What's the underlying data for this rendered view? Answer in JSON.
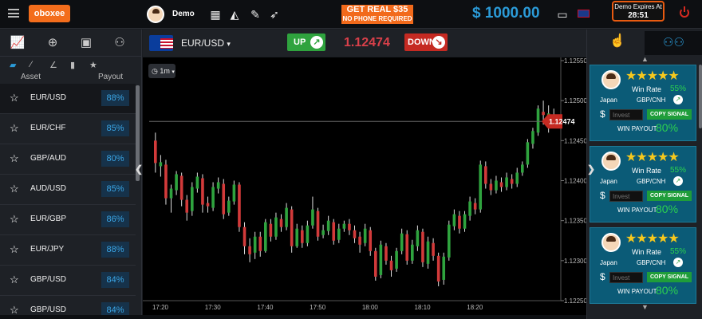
{
  "top": {
    "logo": "oboxee",
    "user": "Demo",
    "promo_line1": "GET REAL $35",
    "promo_line2": "NO PHONE REQUIRED",
    "balance": "$ 1000.00",
    "expiry_label": "Demo Expires At",
    "expiry_time": "28:51"
  },
  "left": {
    "head_asset": "Asset",
    "head_payout": "Payout",
    "assets": [
      {
        "name": "EUR/USD",
        "payout": "88%"
      },
      {
        "name": "EUR/CHF",
        "payout": "85%"
      },
      {
        "name": "GBP/AUD",
        "payout": "80%"
      },
      {
        "name": "AUD/USD",
        "payout": "85%"
      },
      {
        "name": "EUR/GBP",
        "payout": "86%"
      },
      {
        "name": "EUR/JPY",
        "payout": "88%"
      },
      {
        "name": "GBP/USD",
        "payout": "84%"
      },
      {
        "name": "GBP/USD",
        "payout": "84%"
      }
    ]
  },
  "chart_head": {
    "pair": "EUR/USD",
    "up": "UP",
    "price": "1.12474",
    "down": "DOWN",
    "timeframe": "1m"
  },
  "chart_data": {
    "type": "candlestick",
    "current_price": 1.12474,
    "ylim": [
      1.1225,
      1.1255
    ],
    "y_ticks": [
      "1.12550",
      "1.12500",
      "1.12450",
      "1.12400",
      "1.12350",
      "1.12300",
      "1.12250"
    ],
    "x_ticks": [
      "17:20",
      "17:30",
      "17:40",
      "17:50",
      "18:00",
      "18:10",
      "18:20"
    ],
    "candles": [
      [
        1.1245,
        1.12422,
        1.1246,
        1.1241
      ],
      [
        1.12418,
        1.12423,
        1.12432,
        1.12405
      ],
      [
        1.1242,
        1.12378,
        1.12426,
        1.1237
      ],
      [
        1.12378,
        1.1239,
        1.12395,
        1.1236
      ],
      [
        1.12388,
        1.12408,
        1.12412,
        1.12382
      ],
      [
        1.12406,
        1.12376,
        1.1241,
        1.12368
      ],
      [
        1.12376,
        1.1236,
        1.12382,
        1.1235
      ],
      [
        1.12362,
        1.12392,
        1.12398,
        1.12356
      ],
      [
        1.1239,
        1.12405,
        1.1241,
        1.12385
      ],
      [
        1.12403,
        1.1237,
        1.12408,
        1.1236
      ],
      [
        1.12372,
        1.12368,
        1.1238,
        1.1236
      ],
      [
        1.12366,
        1.12392,
        1.12398,
        1.12362
      ],
      [
        1.1239,
        1.12398,
        1.12404,
        1.12384
      ],
      [
        1.12396,
        1.12358,
        1.12402,
        1.12352
      ],
      [
        1.1236,
        1.12375,
        1.1238,
        1.12356
      ],
      [
        1.12374,
        1.12395,
        1.124,
        1.1237
      ],
      [
        1.12395,
        1.12342,
        1.12398,
        1.12336
      ],
      [
        1.12342,
        1.12318,
        1.12348,
        1.12308
      ],
      [
        1.12318,
        1.12308,
        1.12328,
        1.12298
      ],
      [
        1.1231,
        1.1233,
        1.12336,
        1.12302
      ],
      [
        1.1233,
        1.12312,
        1.12336,
        1.12305
      ],
      [
        1.12312,
        1.12348,
        1.12352,
        1.1231
      ],
      [
        1.12346,
        1.1233,
        1.12352,
        1.12324
      ],
      [
        1.1233,
        1.12354,
        1.1236,
        1.12326
      ],
      [
        1.12352,
        1.12342,
        1.12358,
        1.12336
      ],
      [
        1.12342,
        1.12366,
        1.12372,
        1.12338
      ],
      [
        1.12364,
        1.12318,
        1.12368,
        1.1231
      ],
      [
        1.12318,
        1.1234,
        1.12346,
        1.12316
      ],
      [
        1.12338,
        1.12322,
        1.12344,
        1.12316
      ],
      [
        1.12322,
        1.12344,
        1.1235,
        1.12318
      ],
      [
        1.12344,
        1.12364,
        1.1238,
        1.1234
      ],
      [
        1.12362,
        1.1233,
        1.12366,
        1.12325
      ],
      [
        1.12332,
        1.12338,
        1.12345,
        1.12328
      ],
      [
        1.12337,
        1.1235,
        1.12356,
        1.12332
      ],
      [
        1.12348,
        1.12325,
        1.12352,
        1.1232
      ],
      [
        1.12326,
        1.1234,
        1.12346,
        1.12322
      ],
      [
        1.1234,
        1.12346,
        1.1235,
        1.12336
      ],
      [
        1.12346,
        1.12338,
        1.12352,
        1.12332
      ],
      [
        1.12338,
        1.12328,
        1.12344,
        1.12322
      ],
      [
        1.1233,
        1.1232,
        1.12336,
        1.1231
      ],
      [
        1.12322,
        1.1234,
        1.12346,
        1.12318
      ],
      [
        1.12338,
        1.12312,
        1.12342,
        1.12306
      ],
      [
        1.12312,
        1.1228,
        1.12316,
        1.12275
      ],
      [
        1.12282,
        1.1232,
        1.12325,
        1.12278
      ],
      [
        1.12318,
        1.123,
        1.12322,
        1.12295
      ],
      [
        1.123,
        1.12288,
        1.12306,
        1.1228
      ],
      [
        1.1229,
        1.12312,
        1.12316,
        1.12286
      ],
      [
        1.12312,
        1.12334,
        1.1234,
        1.12308
      ],
      [
        1.12333,
        1.123,
        1.12338,
        1.12295
      ],
      [
        1.123,
        1.1232,
        1.12326,
        1.12296
      ],
      [
        1.12318,
        1.12338,
        1.12344,
        1.12312
      ],
      [
        1.12336,
        1.12298,
        1.1234,
        1.12292
      ],
      [
        1.12296,
        1.12324,
        1.1233,
        1.1229
      ],
      [
        1.12322,
        1.12306,
        1.12328,
        1.123
      ],
      [
        1.12306,
        1.12274,
        1.1231,
        1.12268
      ],
      [
        1.12276,
        1.12305,
        1.1231,
        1.1227
      ],
      [
        1.12304,
        1.12345,
        1.1235,
        1.123
      ],
      [
        1.12343,
        1.12358,
        1.12364,
        1.12338
      ],
      [
        1.12356,
        1.1234,
        1.12362,
        1.12334
      ],
      [
        1.1234,
        1.12358,
        1.12362,
        1.12336
      ],
      [
        1.12356,
        1.12374,
        1.1238,
        1.1235
      ],
      [
        1.12372,
        1.12364,
        1.12378,
        1.12358
      ],
      [
        1.12364,
        1.1242,
        1.12425,
        1.1236
      ],
      [
        1.12418,
        1.12396,
        1.12424,
        1.1239
      ],
      [
        1.12396,
        1.12388,
        1.12402,
        1.12382
      ],
      [
        1.12388,
        1.124,
        1.12406,
        1.12384
      ],
      [
        1.12398,
        1.12392,
        1.12404,
        1.12386
      ],
      [
        1.12392,
        1.12404,
        1.1241,
        1.12388
      ],
      [
        1.12402,
        1.12396,
        1.12408,
        1.1239
      ],
      [
        1.12396,
        1.1241,
        1.12416,
        1.12392
      ],
      [
        1.1241,
        1.1242,
        1.12424,
        1.12406
      ],
      [
        1.1242,
        1.12448,
        1.12452,
        1.12416
      ],
      [
        1.12446,
        1.12462,
        1.12466,
        1.1244
      ],
      [
        1.1246,
        1.1249,
        1.12494,
        1.12456
      ],
      [
        1.12486,
        1.12482,
        1.125,
        1.1247
      ],
      [
        1.1248,
        1.12484,
        1.12494,
        1.1246
      ],
      [
        1.1248,
        1.12474,
        1.1249,
        1.12468
      ]
    ]
  },
  "right": {
    "traders": [
      {
        "win_rate_label": "Win Rate",
        "win_rate": "55%",
        "country": "Japan",
        "pair": "GBP/CNH",
        "invest_placeholder": "Invest",
        "copy": "COPY SIGNAL",
        "payout_label": "WIN PAYOUT",
        "payout": "80%"
      },
      {
        "win_rate_label": "Win Rate",
        "win_rate": "55%",
        "country": "Japan",
        "pair": "GBP/CNH",
        "invest_placeholder": "Invest",
        "copy": "COPY SIGNAL",
        "payout_label": "WIN PAYOUT",
        "payout": "80%"
      },
      {
        "win_rate_label": "Win Rate",
        "win_rate": "55%",
        "country": "Japan",
        "pair": "GBP/CNH",
        "invest_placeholder": "Invest",
        "copy": "COPY SIGNAL",
        "payout_label": "WIN PAYOUT",
        "payout": "80%"
      }
    ]
  },
  "colors": {
    "up": "#2fa33e",
    "down": "#d23a3a",
    "accent": "#2b9bd8",
    "promo": "#f26a1b"
  }
}
